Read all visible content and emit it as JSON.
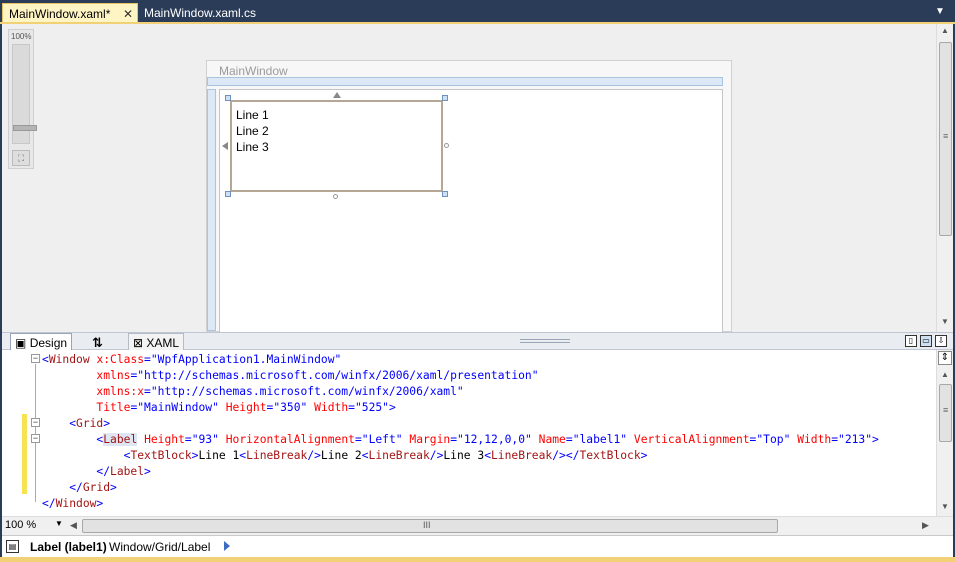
{
  "tabs": {
    "active": {
      "label": "MainWindow.xaml*",
      "close": "✕"
    },
    "inactive": {
      "label": "MainWindow.xaml.cs"
    },
    "dropdown": "▼"
  },
  "designer": {
    "zoom_percent": "100%",
    "window_title": "MainWindow",
    "label_lines": [
      "Line 1",
      "Line 2",
      "Line 3"
    ]
  },
  "splitter": {
    "design_tab": "Design",
    "swap_icon": "⇅",
    "xaml_tab": "XAML"
  },
  "editor": {
    "lines": [
      [
        [
          "t-br",
          "<"
        ],
        [
          "t-tag",
          "Window"
        ],
        [
          "t-text",
          " "
        ],
        [
          "t-attr",
          "x:Class"
        ],
        [
          "t-br",
          "="
        ],
        [
          "t-val",
          "\"WpfApplication1.MainWindow\""
        ]
      ],
      [
        [
          "t-text",
          "        "
        ],
        [
          "t-attr",
          "xmlns"
        ],
        [
          "t-br",
          "="
        ],
        [
          "t-val",
          "\"http://schemas.microsoft.com/winfx/2006/xaml/presentation\""
        ]
      ],
      [
        [
          "t-text",
          "        "
        ],
        [
          "t-attr",
          "xmlns:x"
        ],
        [
          "t-br",
          "="
        ],
        [
          "t-val",
          "\"http://schemas.microsoft.com/winfx/2006/xaml\""
        ]
      ],
      [
        [
          "t-text",
          "        "
        ],
        [
          "t-attr",
          "Title"
        ],
        [
          "t-br",
          "="
        ],
        [
          "t-val",
          "\"MainWindow\""
        ],
        [
          "t-text",
          " "
        ],
        [
          "t-attr",
          "Height"
        ],
        [
          "t-br",
          "="
        ],
        [
          "t-val",
          "\"350\""
        ],
        [
          "t-text",
          " "
        ],
        [
          "t-attr",
          "Width"
        ],
        [
          "t-br",
          "="
        ],
        [
          "t-val",
          "\"525\""
        ],
        [
          "t-br",
          ">"
        ]
      ],
      [
        [
          "t-text",
          "    "
        ],
        [
          "t-br",
          "<"
        ],
        [
          "t-tag",
          "Grid"
        ],
        [
          "t-br",
          ">"
        ]
      ],
      [
        [
          "t-text",
          "        "
        ],
        [
          "t-br",
          "<"
        ],
        [
          "t-tag t-hl",
          "Label"
        ],
        [
          "t-text",
          " "
        ],
        [
          "t-attr",
          "Height"
        ],
        [
          "t-br",
          "="
        ],
        [
          "t-val",
          "\"93\""
        ],
        [
          "t-text",
          " "
        ],
        [
          "t-attr",
          "HorizontalAlignment"
        ],
        [
          "t-br",
          "="
        ],
        [
          "t-val",
          "\"Left\""
        ],
        [
          "t-text",
          " "
        ],
        [
          "t-attr",
          "Margin"
        ],
        [
          "t-br",
          "="
        ],
        [
          "t-val",
          "\"12,12,0,0\""
        ],
        [
          "t-text",
          " "
        ],
        [
          "t-attr",
          "Name"
        ],
        [
          "t-br",
          "="
        ],
        [
          "t-val",
          "\"label1\""
        ],
        [
          "t-text",
          " "
        ],
        [
          "t-attr",
          "VerticalAlignment"
        ],
        [
          "t-br",
          "="
        ],
        [
          "t-val",
          "\"Top\""
        ],
        [
          "t-text",
          " "
        ],
        [
          "t-attr",
          "Width"
        ],
        [
          "t-br",
          "="
        ],
        [
          "t-val",
          "\"213\""
        ],
        [
          "t-br",
          ">"
        ]
      ],
      [
        [
          "t-text",
          "            "
        ],
        [
          "t-br",
          "<"
        ],
        [
          "t-tag",
          "TextBlock"
        ],
        [
          "t-br",
          ">"
        ],
        [
          "t-text",
          "Line 1"
        ],
        [
          "t-br",
          "<"
        ],
        [
          "t-tag",
          "LineBreak"
        ],
        [
          "t-br",
          "/>"
        ],
        [
          "t-text",
          "Line 2"
        ],
        [
          "t-br",
          "<"
        ],
        [
          "t-tag",
          "LineBreak"
        ],
        [
          "t-br",
          "/>"
        ],
        [
          "t-text",
          "Line 3"
        ],
        [
          "t-br",
          "<"
        ],
        [
          "t-tag",
          "LineBreak"
        ],
        [
          "t-br",
          "/></"
        ],
        [
          "t-tag",
          "TextBlock"
        ],
        [
          "t-br",
          ">"
        ]
      ],
      [
        [
          "t-text",
          "        "
        ],
        [
          "t-br",
          "</"
        ],
        [
          "t-tag",
          "Label"
        ],
        [
          "t-br",
          ">"
        ]
      ],
      [
        [
          "t-text",
          "    "
        ],
        [
          "t-br",
          "</"
        ],
        [
          "t-tag",
          "Grid"
        ],
        [
          "t-br",
          ">"
        ]
      ],
      [
        [
          "t-br",
          "</"
        ],
        [
          "t-tag",
          "Window"
        ],
        [
          "t-br",
          ">"
        ]
      ]
    ]
  },
  "hbar": {
    "zoom": "100 %",
    "grip": "III"
  },
  "status": {
    "element": "Label (label1)",
    "path": "Window/Grid/Label"
  },
  "colors": {
    "chrome": "#2b3c59",
    "active_tab": "#fff4c4",
    "accent_gold": "#f2d176"
  }
}
